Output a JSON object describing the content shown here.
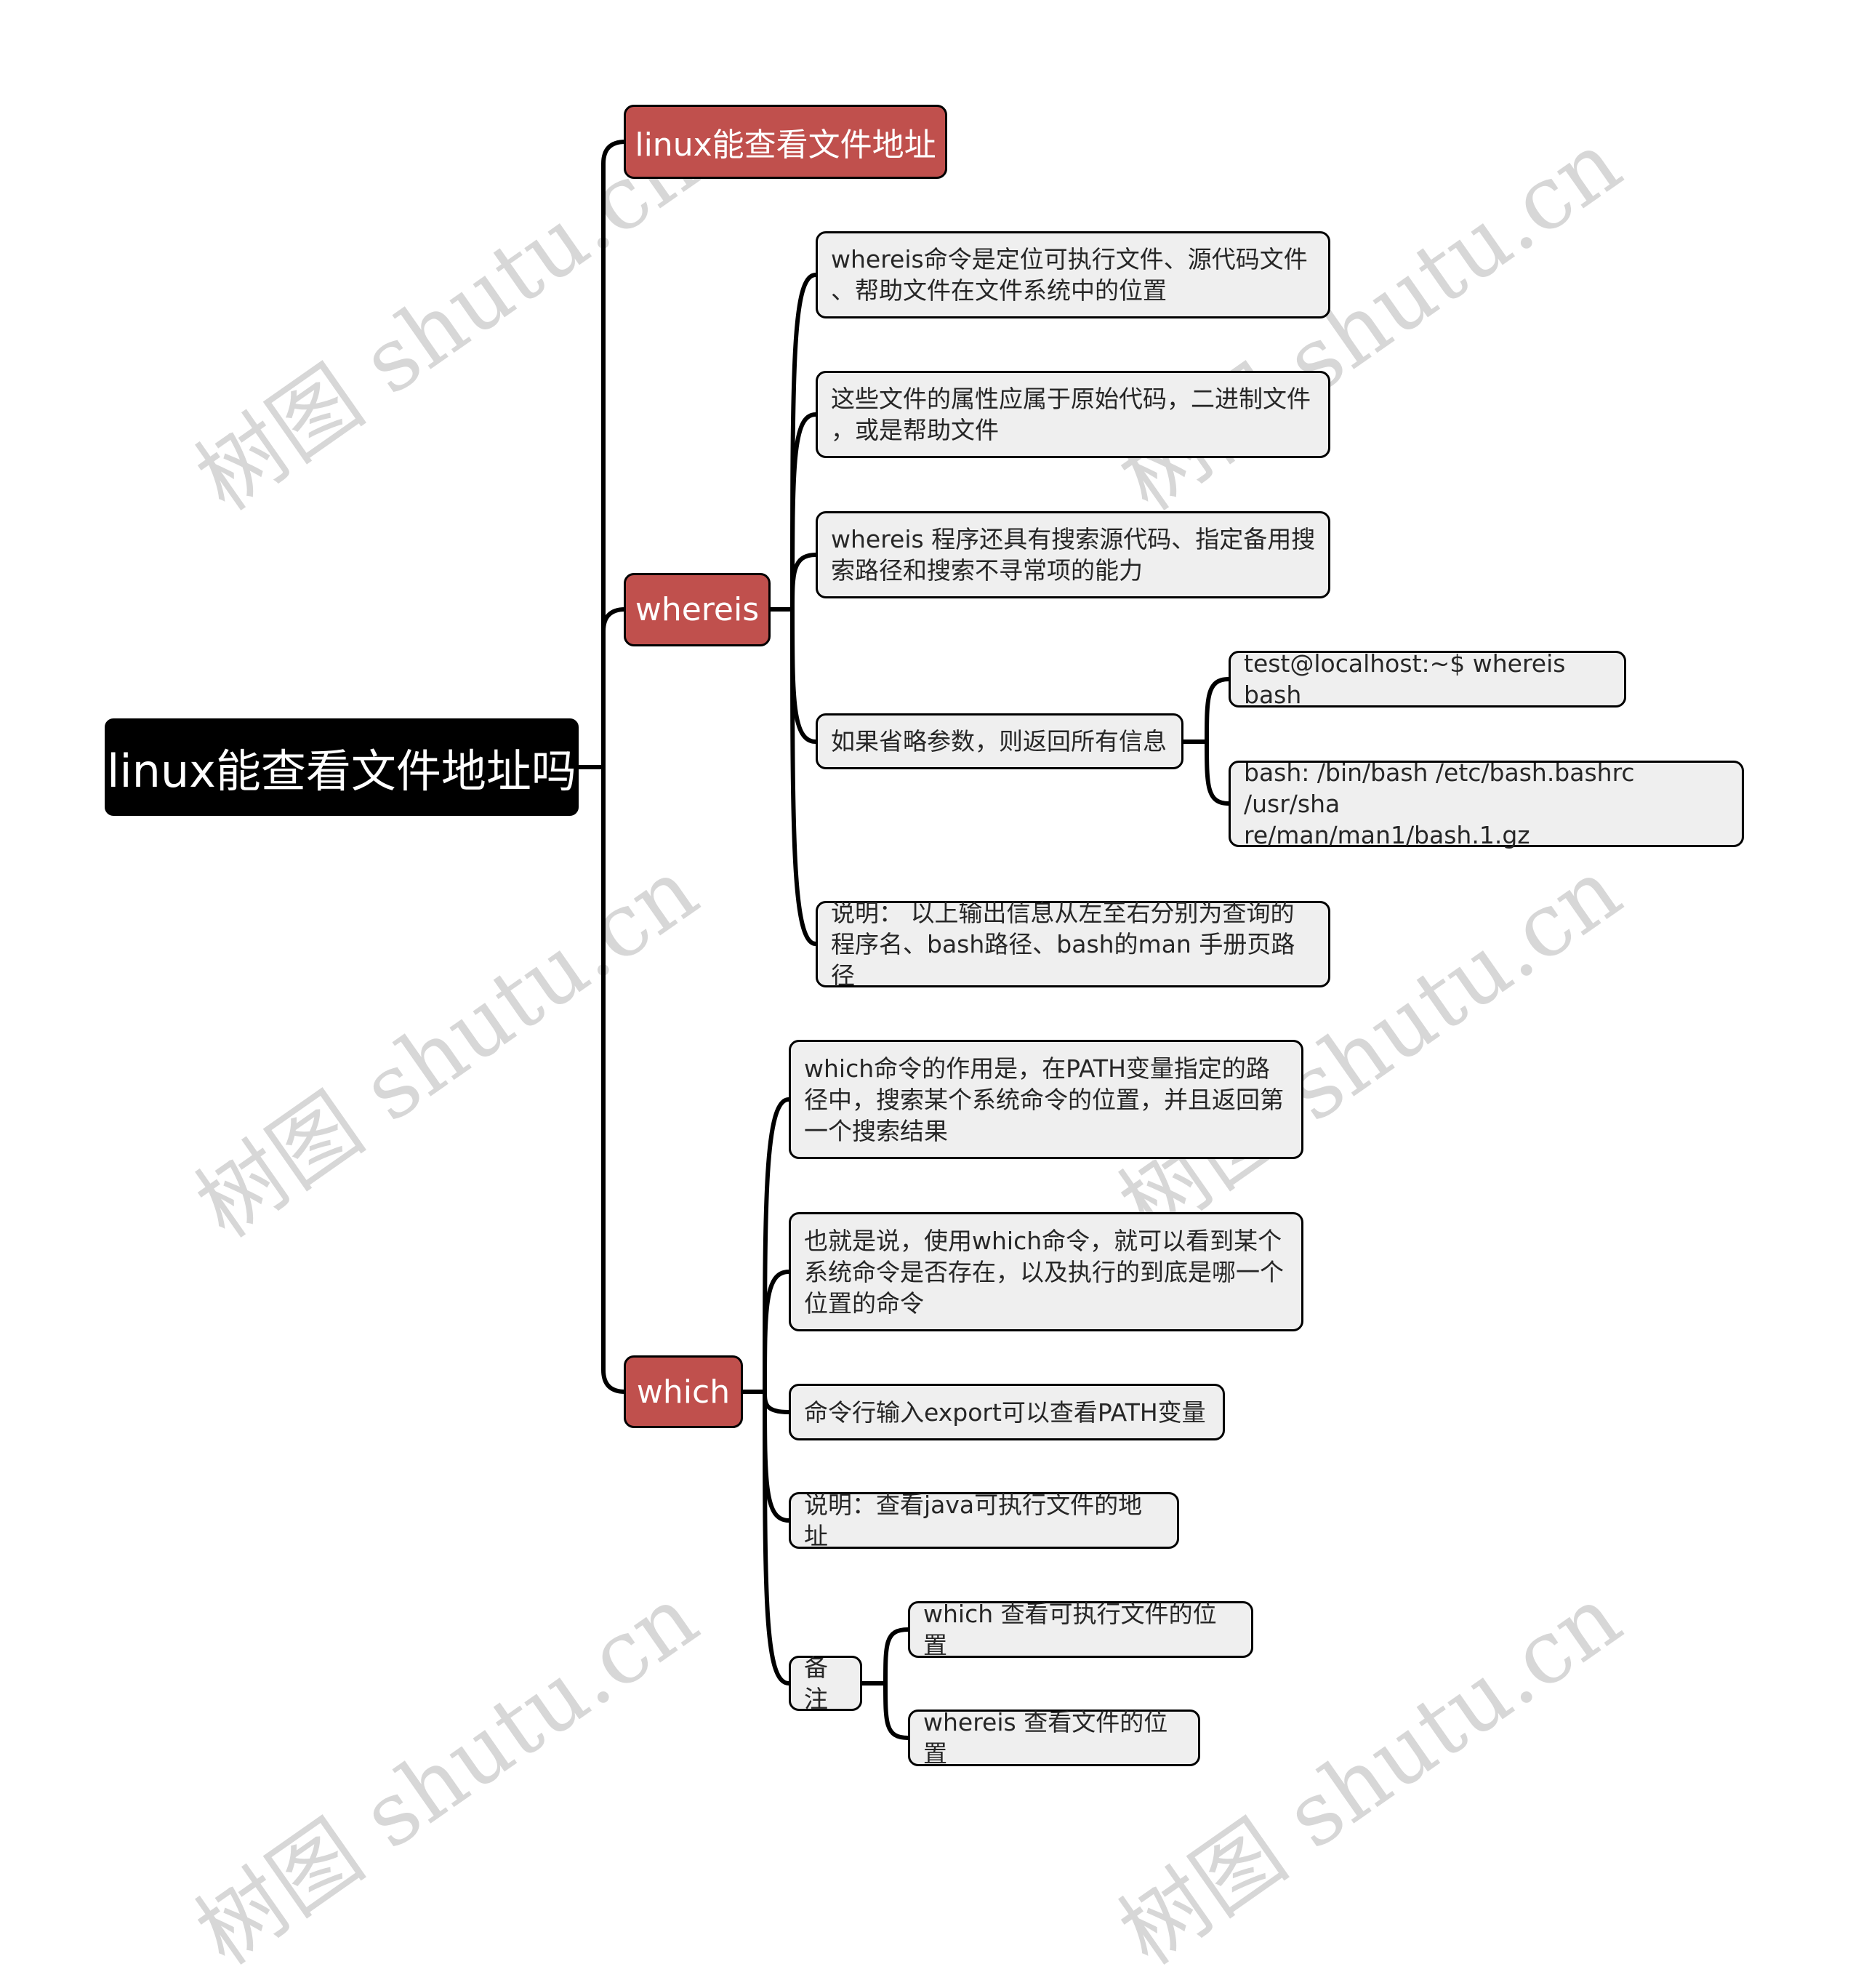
{
  "watermark": "树图 shutu.cn",
  "colors": {
    "root_bg": "#000000",
    "main_bg": "#c0504d",
    "leaf_bg": "#efefef",
    "line": "#000000",
    "watermark": "#d7d7d7"
  },
  "root": {
    "label": "linux能查看文件地址吗"
  },
  "branches": [
    {
      "label": "linux能查看文件地址",
      "children": []
    },
    {
      "label": "whereis",
      "children": [
        {
          "label": "whereis命令是定位可执行文件、源代码文件、帮助文件在文件系统中的位置",
          "lines": [
            "whereis命令是定位可执行文件、源代码文件",
            "、帮助文件在文件系统中的位置"
          ]
        },
        {
          "label": "这些文件的属性应属于原始代码，二进制文件，或是帮助文件",
          "lines": [
            "这些文件的属性应属于原始代码，二进制文件",
            "，或是帮助文件"
          ]
        },
        {
          "label": "whereis 程序还具有搜索源代码、指定备用搜索路径和搜索不寻常项的能力",
          "lines": [
            "whereis 程序还具有搜索源代码、指定备用搜",
            "索路径和搜索不寻常项的能力"
          ]
        },
        {
          "label": "如果省略参数，则返回所有信息",
          "lines": [
            "如果省略参数，则返回所有信息"
          ],
          "children": [
            {
              "label": "test@localhost:~$ whereis bash",
              "lines": [
                "test@localhost:~$ whereis bash"
              ]
            },
            {
              "label": "bash: /bin/bash /etc/bash.bashrc /usr/share/man/man1/bash.1.gz",
              "lines": [
                "bash: /bin/bash /etc/bash.bashrc /usr/sha",
                "re/man/man1/bash.1.gz"
              ]
            }
          ]
        },
        {
          "label": "说明： 以上输出信息从左至右分别为查询的程序名、bash路径、bash的man 手册页路径",
          "lines": [
            "说明： 以上输出信息从左至右分别为查询的",
            "程序名、bash路径、bash的man 手册页路径"
          ]
        }
      ]
    },
    {
      "label": "which",
      "children": [
        {
          "label": "which命令的作用是，在PATH变量指定的路径中，搜索某个系统命令的位置，并且返回第一个搜索结果",
          "lines": [
            "which命令的作用是，在PATH变量指定的路",
            "径中，搜索某个系统命令的位置，并且返回第",
            "一个搜索结果"
          ]
        },
        {
          "label": "也就是说，使用which命令，就可以看到某个系统命令是否存在，以及执行的到底是哪一个位置的命令",
          "lines": [
            "也就是说，使用which命令，就可以看到某个",
            "系统命令是否存在，以及执行的到底是哪一个",
            "位置的命令"
          ]
        },
        {
          "label": "命令行输入export可以查看PATH变量",
          "lines": [
            "命令行输入export可以查看PATH变量"
          ]
        },
        {
          "label": "说明：查看java可执行文件的地址",
          "lines": [
            "说明：查看java可执行文件的地址"
          ]
        },
        {
          "label": "备注",
          "lines": [
            "备注"
          ],
          "children": [
            {
              "label": "which 查看可执行文件的位置",
              "lines": [
                "which 查看可执行文件的位置"
              ]
            },
            {
              "label": "whereis 查看文件的位置",
              "lines": [
                "whereis 查看文件的位置"
              ]
            }
          ]
        }
      ]
    }
  ]
}
